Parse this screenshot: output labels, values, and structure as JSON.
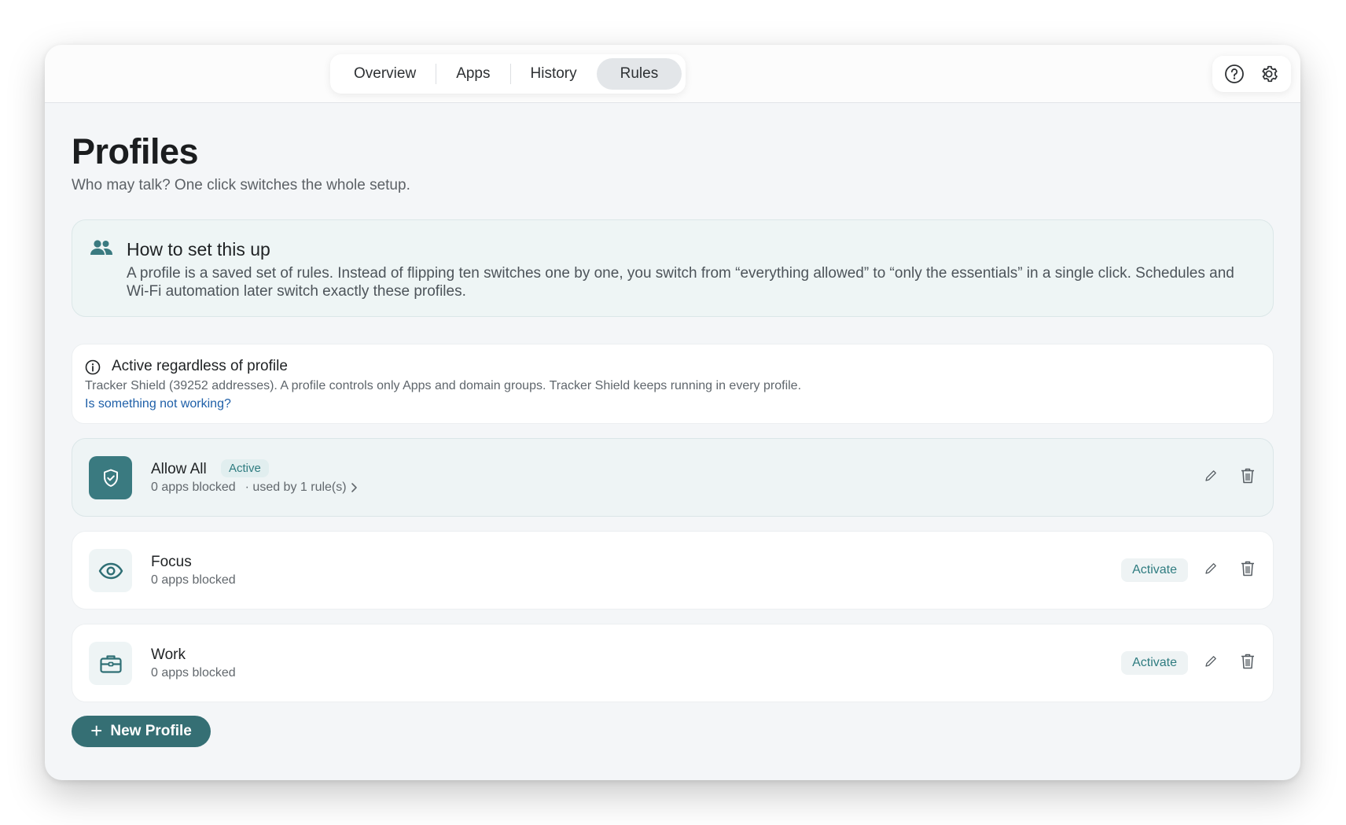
{
  "tabs": [
    {
      "label": "Overview"
    },
    {
      "label": "Apps"
    },
    {
      "label": "History"
    },
    {
      "label": "Rules"
    }
  ],
  "active_tab": "Rules",
  "header": {
    "title": "Profiles",
    "subtitle": "Who may talk? One click switches the whole setup."
  },
  "howto": {
    "title": "How to set this up",
    "text": "A profile is a saved set of rules. Instead of flipping ten switches one by one, you switch from “everything allowed” to “only the essentials” in a single click. Schedules and Wi-Fi automation later switch exactly these profiles."
  },
  "notice": {
    "title": "Active regardless of profile",
    "text": "Tracker Shield (39252 addresses). A profile controls only Apps and domain groups. Tracker Shield keeps running in every profile.",
    "link": "Is something not working?"
  },
  "profiles": [
    {
      "name": "Allow All",
      "badge": "Active",
      "meta": "0 apps blocked",
      "used": "· used by 1 rule(s)",
      "icon": "shield-check-icon"
    },
    {
      "name": "Focus",
      "meta": "0 apps blocked",
      "action": "Activate",
      "icon": "eye-icon"
    },
    {
      "name": "Work",
      "meta": "0 apps blocked",
      "action": "Activate",
      "icon": "briefcase-icon"
    }
  ],
  "new_profile_label": "New Profile",
  "colors": {
    "accent": "#356f74",
    "accent_light": "#e1eeef",
    "link": "#1e5fa8"
  }
}
